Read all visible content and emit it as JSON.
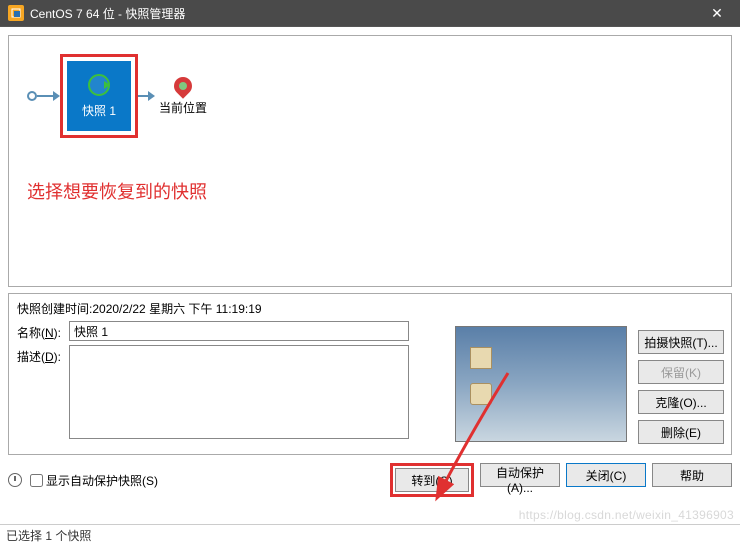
{
  "titlebar": {
    "title": "CentOS 7 64 位 - 快照管理器"
  },
  "diagram": {
    "snapshot_label": "快照 1",
    "current_position": "当前位置",
    "annotation": "选择想要恢复到的快照"
  },
  "details": {
    "created_label": "快照创建时间:",
    "created_value": "2020/2/22 星期六 下午 11:19:19",
    "name_label_pre": "名称(",
    "name_label_key": "N",
    "name_label_post": "):",
    "name_value": "快照 1",
    "desc_label_pre": "描述(",
    "desc_label_key": "D",
    "desc_label_post": "):",
    "desc_value": ""
  },
  "side_buttons": {
    "take": "拍摄快照(T)...",
    "keep": "保留(K)",
    "clone": "克隆(O)...",
    "delete": "删除(E)"
  },
  "bottom": {
    "show_autoprotect": "显示自动保护快照(S)",
    "goto": "转到(G)",
    "autoprotect": "自动保护(A)...",
    "close": "关闭(C)",
    "help": "帮助"
  },
  "status": "已选择 1 个快照",
  "watermark": "https://blog.csdn.net/weixin_41396903"
}
